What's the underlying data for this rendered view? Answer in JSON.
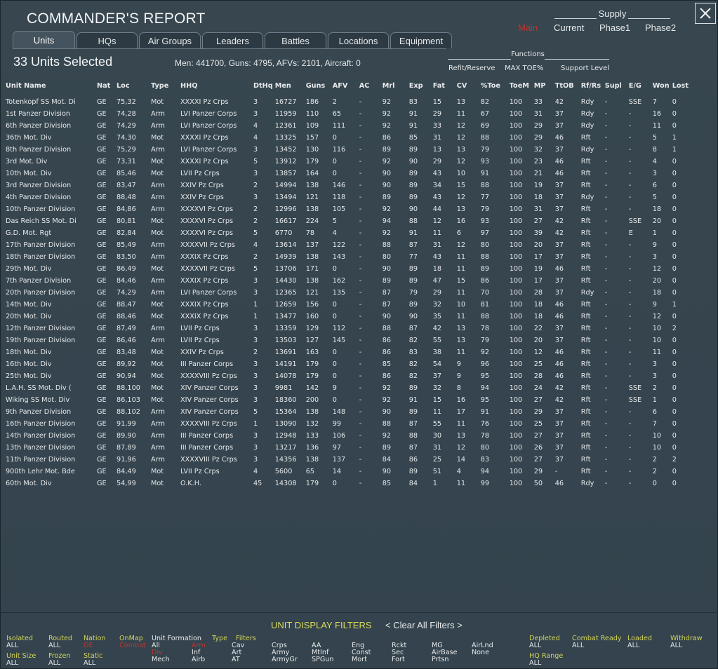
{
  "window": {
    "title": "COMMANDER'S REPORT"
  },
  "supply": {
    "title": "Supply",
    "options": [
      "Main",
      "Current",
      "Phase1",
      "Phase2"
    ],
    "selected": "Main"
  },
  "tabs": [
    "Units",
    "HQs",
    "Air Groups",
    "Leaders",
    "Battles",
    "Locations",
    "Equipment"
  ],
  "active_tab": "Units",
  "header": {
    "selected_count": "33 Units Selected",
    "summary": "Men: 441700, Guns: 4795, AFVs: 2101, Aircraft: 0"
  },
  "functions": {
    "title": "Functions",
    "items": [
      "Refit/Reserve",
      "MAX TOE%",
      "Support Level"
    ]
  },
  "table": {
    "columns": [
      "Unit Name",
      "Nat",
      "Loc",
      "Type",
      "HHQ",
      "DtHq",
      "Men",
      "Guns",
      "AFV",
      "AC",
      "Mrl",
      "Exp",
      "Fat",
      "CV",
      "%Toe",
      "ToeM",
      "MP",
      "TtOB",
      "Rf/Rs",
      "Supl",
      "E/G",
      "Won",
      "Lost"
    ],
    "rows": [
      [
        "Totenkopf SS Mot. Di",
        "GE",
        "75,32",
        "Mot",
        "XXXXI Pz Crps",
        "3",
        "16727",
        "186",
        "2",
        "-",
        "92",
        "83",
        "15",
        "13",
        "82",
        "100",
        "33",
        "42",
        "Rdy",
        "-",
        "SSE",
        "7",
        "0"
      ],
      [
        "1st Panzer Division",
        "GE",
        "74,28",
        "Arm",
        "LVI Panzer Corps",
        "3",
        "11959",
        "110",
        "65",
        "-",
        "92",
        "91",
        "29",
        "11",
        "67",
        "100",
        "31",
        "37",
        "Rdy",
        "-",
        "-",
        "16",
        "0"
      ],
      [
        "6th Panzer Division",
        "GE",
        "74,29",
        "Arm",
        "LVI Panzer Corps",
        "4",
        "12361",
        "109",
        "111",
        "-",
        "92",
        "91",
        "33",
        "12",
        "69",
        "100",
        "29",
        "37",
        "Rdy",
        "-",
        "-",
        "11",
        "0"
      ],
      [
        "36th Mot. Div",
        "GE",
        "74,30",
        "Mot",
        "XXXXI Pz Crps",
        "4",
        "13325",
        "157",
        "0",
        "-",
        "86",
        "85",
        "31",
        "12",
        "88",
        "100",
        "29",
        "46",
        "Rft",
        "-",
        "-",
        "5",
        "1"
      ],
      [
        "8th Panzer Division",
        "GE",
        "75,29",
        "Arm",
        "LVI Panzer Corps",
        "3",
        "13452",
        "130",
        "116",
        "-",
        "89",
        "89",
        "13",
        "13",
        "79",
        "100",
        "32",
        "37",
        "Rdy",
        "-",
        "-",
        "8",
        "1"
      ],
      [
        "3rd Mot. Div",
        "GE",
        "73,31",
        "Mot",
        "XXXXI Pz Crps",
        "5",
        "13912",
        "179",
        "0",
        "-",
        "92",
        "90",
        "29",
        "12",
        "93",
        "100",
        "23",
        "46",
        "Rft",
        "-",
        "-",
        "4",
        "0"
      ],
      [
        "10th Mot. Div",
        "GE",
        "85,46",
        "Mot",
        "LVII Pz Crps",
        "3",
        "13857",
        "164",
        "0",
        "-",
        "90",
        "89",
        "43",
        "10",
        "91",
        "100",
        "21",
        "46",
        "Rft",
        "-",
        "-",
        "3",
        "0"
      ],
      [
        "3rd Panzer Division",
        "GE",
        "83,47",
        "Arm",
        "XXIV Pz Crps",
        "2",
        "14994",
        "138",
        "146",
        "-",
        "90",
        "89",
        "34",
        "15",
        "88",
        "100",
        "19",
        "37",
        "Rft",
        "-",
        "-",
        "6",
        "0"
      ],
      [
        "4th Panzer Division",
        "GE",
        "88,48",
        "Arm",
        "XXIV Pz Crps",
        "3",
        "13494",
        "121",
        "118",
        "-",
        "89",
        "89",
        "43",
        "12",
        "77",
        "100",
        "18",
        "37",
        "Rdy",
        "-",
        "-",
        "5",
        "0"
      ],
      [
        "10th Panzer Division",
        "GE",
        "84,86",
        "Arm",
        "XXXXVI Pz Crps",
        "2",
        "12996",
        "138",
        "105",
        "-",
        "92",
        "90",
        "44",
        "13",
        "79",
        "100",
        "31",
        "37",
        "Rft",
        "-",
        "-",
        "18",
        "0"
      ],
      [
        "Das Reich SS Mot. Di",
        "GE",
        "80,81",
        "Mot",
        "XXXXVI Pz Crps",
        "2",
        "16617",
        "224",
        "5",
        "-",
        "94",
        "88",
        "12",
        "16",
        "93",
        "100",
        "27",
        "42",
        "Rft",
        "-",
        "SSE",
        "20",
        "0"
      ],
      [
        "G.D. Mot. Rgt",
        "GE",
        "82,84",
        "Mot",
        "XXXXVI Pz Crps",
        "5",
        "6770",
        "78",
        "4",
        "-",
        "92",
        "91",
        "11",
        "6",
        "97",
        "100",
        "39",
        "42",
        "Rft",
        "-",
        "E",
        "1",
        "0"
      ],
      [
        "17th Panzer Division",
        "GE",
        "85,49",
        "Arm",
        "XXXXVII Pz Crps",
        "4",
        "13614",
        "137",
        "122",
        "-",
        "88",
        "87",
        "31",
        "12",
        "80",
        "100",
        "20",
        "37",
        "Rft",
        "-",
        "-",
        "9",
        "0"
      ],
      [
        "18th Panzer Division",
        "GE",
        "83,50",
        "Arm",
        "XXXIX Pz Crps",
        "2",
        "14939",
        "138",
        "143",
        "-",
        "80",
        "77",
        "43",
        "11",
        "88",
        "100",
        "17",
        "37",
        "Rft",
        "-",
        "-",
        "3",
        "0"
      ],
      [
        "29th Mot. Div",
        "GE",
        "86,49",
        "Mot",
        "XXXXVII Pz Crps",
        "5",
        "13706",
        "171",
        "0",
        "-",
        "90",
        "89",
        "18",
        "11",
        "89",
        "100",
        "19",
        "46",
        "Rft",
        "-",
        "-",
        "12",
        "0"
      ],
      [
        "7th Panzer Division",
        "GE",
        "84,46",
        "Arm",
        "XXXIX Pz Crps",
        "3",
        "14430",
        "138",
        "162",
        "-",
        "89",
        "89",
        "47",
        "15",
        "86",
        "100",
        "17",
        "37",
        "Rft",
        "-",
        "-",
        "20",
        "0"
      ],
      [
        "20th Panzer Division",
        "GE",
        "74,29",
        "Arm",
        "LVI Panzer Corps",
        "3",
        "12365",
        "121",
        "135",
        "-",
        "87",
        "79",
        "29",
        "11",
        "70",
        "100",
        "28",
        "37",
        "Rdy",
        "-",
        "-",
        "18",
        "0"
      ],
      [
        "14th Mot. Div",
        "GE",
        "88,47",
        "Mot",
        "XXXIX Pz Crps",
        "1",
        "12659",
        "156",
        "0",
        "-",
        "87",
        "89",
        "32",
        "10",
        "81",
        "100",
        "18",
        "46",
        "Rft",
        "-",
        "-",
        "9",
        "1"
      ],
      [
        "20th Mot. Div",
        "GE",
        "88,46",
        "Mot",
        "XXXIX Pz Crps",
        "1",
        "13477",
        "160",
        "0",
        "-",
        "90",
        "90",
        "35",
        "11",
        "88",
        "100",
        "18",
        "46",
        "Rft",
        "-",
        "-",
        "12",
        "0"
      ],
      [
        "12th Panzer Division",
        "GE",
        "87,49",
        "Arm",
        "LVII Pz Crps",
        "3",
        "13359",
        "129",
        "112",
        "-",
        "88",
        "87",
        "42",
        "13",
        "78",
        "100",
        "22",
        "37",
        "Rft",
        "-",
        "-",
        "10",
        "2"
      ],
      [
        "19th Panzer Division",
        "GE",
        "86,46",
        "Arm",
        "LVII Pz Crps",
        "3",
        "13503",
        "127",
        "145",
        "-",
        "86",
        "82",
        "55",
        "13",
        "79",
        "100",
        "20",
        "37",
        "Rft",
        "-",
        "-",
        "10",
        "0"
      ],
      [
        "18th Mot. Div",
        "GE",
        "83,48",
        "Mot",
        "XXIV Pz Crps",
        "2",
        "13691",
        "163",
        "0",
        "-",
        "86",
        "83",
        "38",
        "11",
        "92",
        "100",
        "12",
        "46",
        "Rft",
        "-",
        "-",
        "11",
        "0"
      ],
      [
        "16th Mot. Div",
        "GE",
        "89,92",
        "Mot",
        "III Panzer Corps",
        "3",
        "14191",
        "179",
        "0",
        "-",
        "85",
        "82",
        "54",
        "9",
        "96",
        "100",
        "25",
        "46",
        "Rft",
        "-",
        "-",
        "3",
        "0"
      ],
      [
        "25th Mot. Div",
        "GE",
        "90,94",
        "Mot",
        "XXXXVIII Pz Crps",
        "3",
        "14078",
        "179",
        "0",
        "-",
        "86",
        "82",
        "37",
        "9",
        "95",
        "100",
        "28",
        "46",
        "Rft",
        "-",
        "-",
        "3",
        "0"
      ],
      [
        "L.A.H. SS Mot. Div (",
        "GE",
        "88,100",
        "Mot",
        "XIV Panzer Corps",
        "3",
        "9981",
        "142",
        "9",
        "-",
        "92",
        "89",
        "32",
        "8",
        "94",
        "100",
        "24",
        "42",
        "Rft",
        "-",
        "SSE",
        "2",
        "0"
      ],
      [
        "Wiking SS Mot. Div",
        "GE",
        "86,103",
        "Mot",
        "XIV Panzer Corps",
        "3",
        "18360",
        "200",
        "0",
        "-",
        "92",
        "91",
        "15",
        "16",
        "95",
        "100",
        "27",
        "42",
        "Rft",
        "-",
        "SSE",
        "1",
        "0"
      ],
      [
        "9th Panzer Division",
        "GE",
        "88,102",
        "Arm",
        "XIV Panzer Corps",
        "5",
        "15364",
        "138",
        "148",
        "-",
        "90",
        "89",
        "11",
        "17",
        "91",
        "100",
        "29",
        "37",
        "Rft",
        "-",
        "-",
        "6",
        "0"
      ],
      [
        "16th Panzer Division",
        "GE",
        "91,99",
        "Arm",
        "XXXXVIII Pz Crps",
        "1",
        "13090",
        "132",
        "99",
        "-",
        "88",
        "87",
        "55",
        "11",
        "76",
        "100",
        "25",
        "37",
        "Rft",
        "-",
        "-",
        "7",
        "0"
      ],
      [
        "14th Panzer Division",
        "GE",
        "89,90",
        "Arm",
        "III Panzer Corps",
        "3",
        "12948",
        "133",
        "106",
        "-",
        "92",
        "88",
        "30",
        "13",
        "78",
        "100",
        "27",
        "37",
        "Rft",
        "-",
        "-",
        "10",
        "0"
      ],
      [
        "13th Panzer Division",
        "GE",
        "87,89",
        "Arm",
        "III Panzer Corps",
        "3",
        "13217",
        "136",
        "97",
        "-",
        "89",
        "87",
        "31",
        "12",
        "80",
        "100",
        "26",
        "37",
        "Rft",
        "-",
        "-",
        "10",
        "0"
      ],
      [
        "11th Panzer Division",
        "GE",
        "91,96",
        "Arm",
        "XXXXVIII Pz Crps",
        "3",
        "14356",
        "138",
        "137",
        "-",
        "84",
        "86",
        "25",
        "14",
        "83",
        "100",
        "27",
        "37",
        "Rft",
        "-",
        "-",
        "2",
        "2"
      ],
      [
        "900th Lehr Mot. Bde",
        "GE",
        "84,49",
        "Mot",
        "LVII Pz Crps",
        "4",
        "5600",
        "65",
        "14",
        "-",
        "90",
        "89",
        "51",
        "4",
        "94",
        "100",
        "29",
        "-",
        "Rft",
        "-",
        "-",
        "2",
        "0"
      ],
      [
        "60th Mot. Div",
        "GE",
        "54,99",
        "Mot",
        "O.K.H.",
        "45",
        "14308",
        "179",
        "0",
        "-",
        "85",
        "84",
        "1",
        "11",
        "99",
        "100",
        "50",
        "46",
        "Rdy",
        "-",
        "-",
        "0",
        "0"
      ]
    ]
  },
  "filters": {
    "title": "UNIT DISPLAY FILTERS",
    "clear": "< Clear All Filters >",
    "isolated": {
      "label": "Isolated",
      "value": "ALL"
    },
    "routed": {
      "label": "Routed",
      "value": "ALL"
    },
    "nation": {
      "label": "Nation",
      "value": "GE"
    },
    "onmap": {
      "label": "OnMap",
      "value": "Combat"
    },
    "unit_formation": {
      "label": "Unit Formation",
      "options": [
        "All",
        "Div",
        "Mech"
      ],
      "values": [
        "Inf",
        "Airb"
      ],
      "selected": "Div"
    },
    "type": {
      "label": "Type",
      "options": [
        "Cav",
        "Art",
        "AT"
      ],
      "selected": "Arm"
    },
    "filters_label": "Filters",
    "type_options": [
      "Crps",
      "Army",
      "ArmyGr",
      "AA",
      "MtInf",
      "SPGun",
      "Eng",
      "Const",
      "Mort",
      "Rckt",
      "Sec",
      "Fort",
      "MG",
      "AirBase",
      "Prtsn",
      "AirLnd",
      "None"
    ],
    "unit_size": {
      "label": "Unit Size",
      "value": "ALL"
    },
    "frozen": {
      "label": "Frozen",
      "value": "ALL"
    },
    "static": {
      "label": "Static",
      "value": "ALL"
    },
    "depleted": {
      "label": "Depleted",
      "value": "ALL"
    },
    "combat_ready": {
      "label": "Combat Ready",
      "value": "ALL"
    },
    "loaded": {
      "label": "Loaded",
      "value": "ALL"
    },
    "withdraw": {
      "label": "Withdraw",
      "value": "ALL"
    },
    "hq_range": {
      "label": "HQ Range",
      "value": "ALL"
    }
  }
}
